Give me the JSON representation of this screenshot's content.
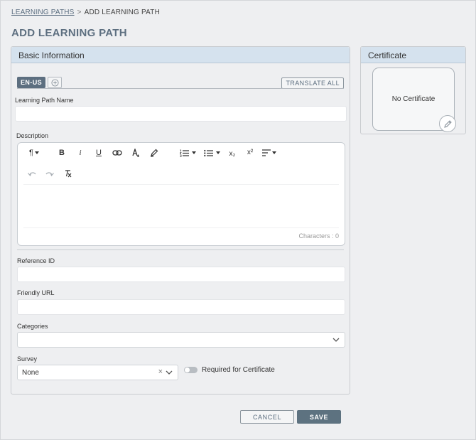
{
  "breadcrumb": {
    "parent": "LEARNING PATHS",
    "separator": ">",
    "current": "ADD LEARNING PATH"
  },
  "page_title": "ADD LEARNING PATH",
  "basic_info": {
    "header": "Basic Information",
    "lang_tab_active": "EN-US",
    "lang_add_icon": "plus-circle-icon",
    "translate_all": "TRANSLATE ALL",
    "name_label": "Learning Path Name",
    "name_value": "",
    "description_label": "Description",
    "characters": "Characters : 0",
    "reference_label": "Reference ID",
    "reference_value": "",
    "friendly_url_label": "Friendly URL",
    "friendly_url_value": "",
    "categories_label": "Categories",
    "categories_value": "",
    "survey_label": "Survey",
    "survey_value": "None",
    "required_label": "Required for Certificate",
    "required_on": false
  },
  "editor_toolbar": {
    "paragraph": "¶",
    "bold": "B",
    "italic": "i",
    "underline": "U",
    "subscript": "x₂",
    "superscript": "x²"
  },
  "certificate": {
    "header": "Certificate",
    "empty_text": "No Certificate"
  },
  "actions": {
    "cancel": "CANCEL",
    "save": "SAVE"
  },
  "colors": {
    "accent": "#5d6f80",
    "panel_header": "#d5e2ee",
    "background": "#eeeff1"
  }
}
